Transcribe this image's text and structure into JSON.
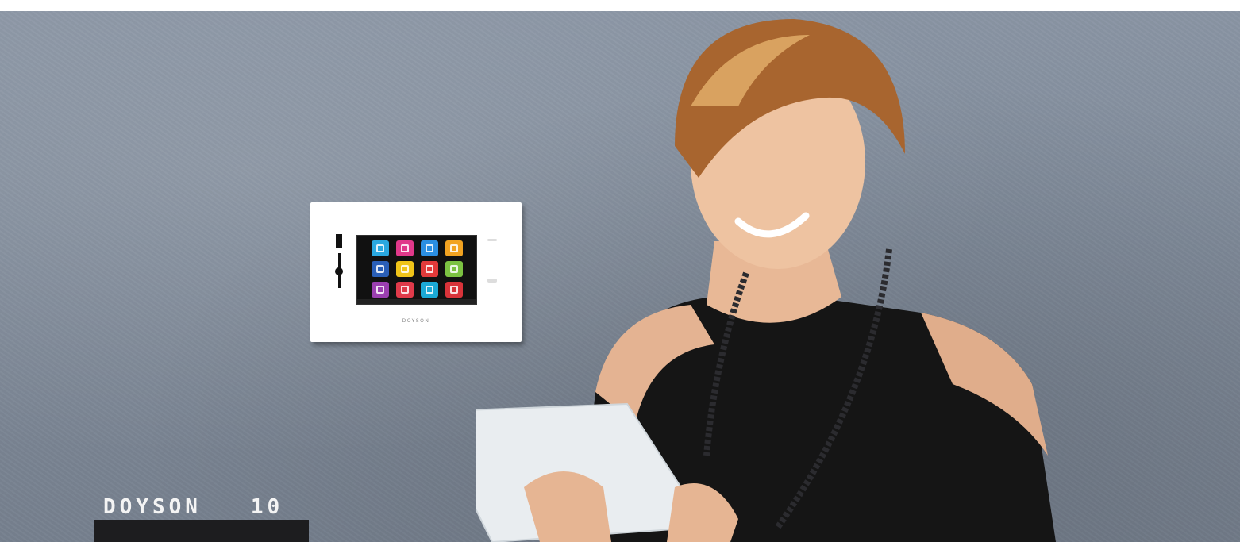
{
  "caption": "DOYSON   10",
  "panel_brand": "DOYSON",
  "app_icons": [
    {
      "name": "phone-icon",
      "color": "#2aa8e0"
    },
    {
      "name": "microphone-icon",
      "color": "#e0388a"
    },
    {
      "name": "music-icon",
      "color": "#2b8fe3"
    },
    {
      "name": "tools-icon",
      "color": "#f2a321"
    },
    {
      "name": "info-icon",
      "color": "#2a5fb8"
    },
    {
      "name": "settings-icon",
      "color": "#f0c419"
    },
    {
      "name": "lock-icon",
      "color": "#e23a3a"
    },
    {
      "name": "home-icon",
      "color": "#7cc242"
    },
    {
      "name": "curtain-icon",
      "color": "#9b3fb0"
    },
    {
      "name": "bell-icon",
      "color": "#e03a4a"
    },
    {
      "name": "camera-icon",
      "color": "#1ba9d6"
    },
    {
      "name": "intercom-icon",
      "color": "#d9333a"
    }
  ],
  "colors": {
    "wall": "#808b9a",
    "panel": "#ffffff",
    "screen": "#111111",
    "caption_text": "#f4f4f4"
  }
}
